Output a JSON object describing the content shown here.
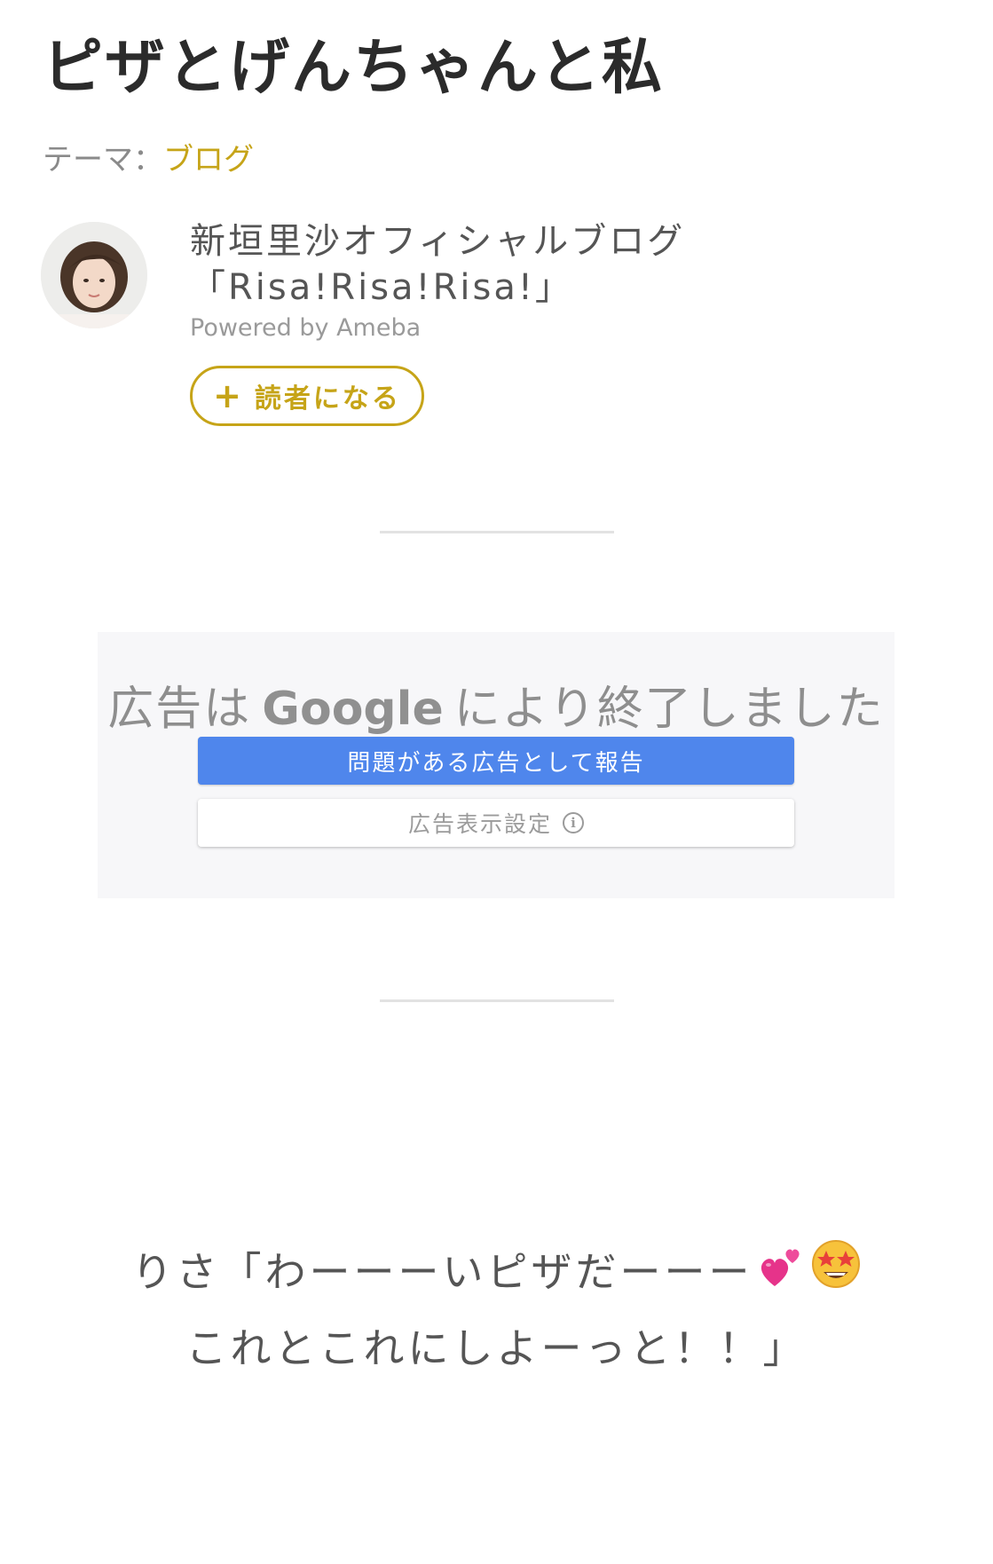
{
  "article": {
    "title": "ピザとげんちゃんと私",
    "theme_prefix": "テーマ：",
    "theme_name": "ブログ"
  },
  "blog": {
    "name_line1": "新垣里沙オフィシャルブログ",
    "name_line2": "「Risa!Risa!Risa!」",
    "powered_by": "Powered by Ameba",
    "follow_label": "読者になる",
    "follow_icon": "plus-icon"
  },
  "ad": {
    "closed_prefix": "広告は",
    "closed_brand": "Google",
    "closed_suffix": "により終了しました",
    "report_label": "問題がある広告として報告",
    "settings_label": "広告表示設定",
    "settings_icon": "info-icon"
  },
  "post": {
    "line1": "りさ「わーーーいピザだーーー",
    "line1_emojis": [
      "two-hearts-icon",
      "star-struck-icon"
    ],
    "line2": "これとこれにしよーっと！！」"
  },
  "colors": {
    "accent": "#c6a418",
    "report_button": "#4f86ec"
  }
}
